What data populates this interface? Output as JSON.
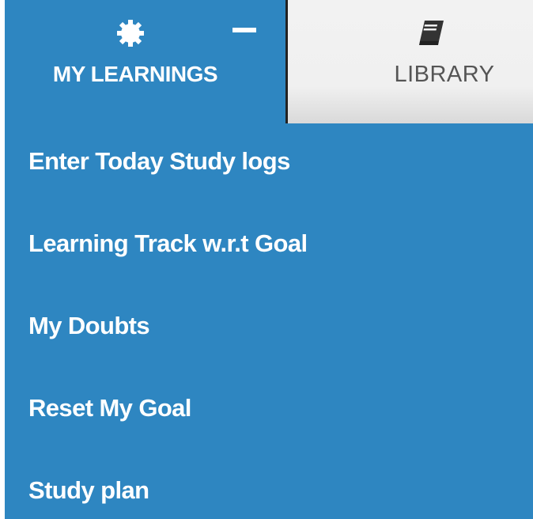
{
  "tabs": {
    "learnings": {
      "label": "MY LEARNINGS",
      "icon": "gear-icon",
      "collapse_icon": "minus-icon",
      "active": true
    },
    "library": {
      "label": "LIBRARY",
      "icon": "book-icon",
      "active": false
    }
  },
  "menu": {
    "items": [
      {
        "label": "Enter Today Study logs"
      },
      {
        "label": "Learning Track w.r.t Goal"
      },
      {
        "label": "My Doubts"
      },
      {
        "label": "Reset My Goal"
      },
      {
        "label": "Study plan"
      }
    ]
  },
  "colors": {
    "primary_blue": "#2e86c1",
    "inactive_tab": "#f0f0f0",
    "inactive_text": "#555555",
    "active_text": "#ffffff"
  }
}
